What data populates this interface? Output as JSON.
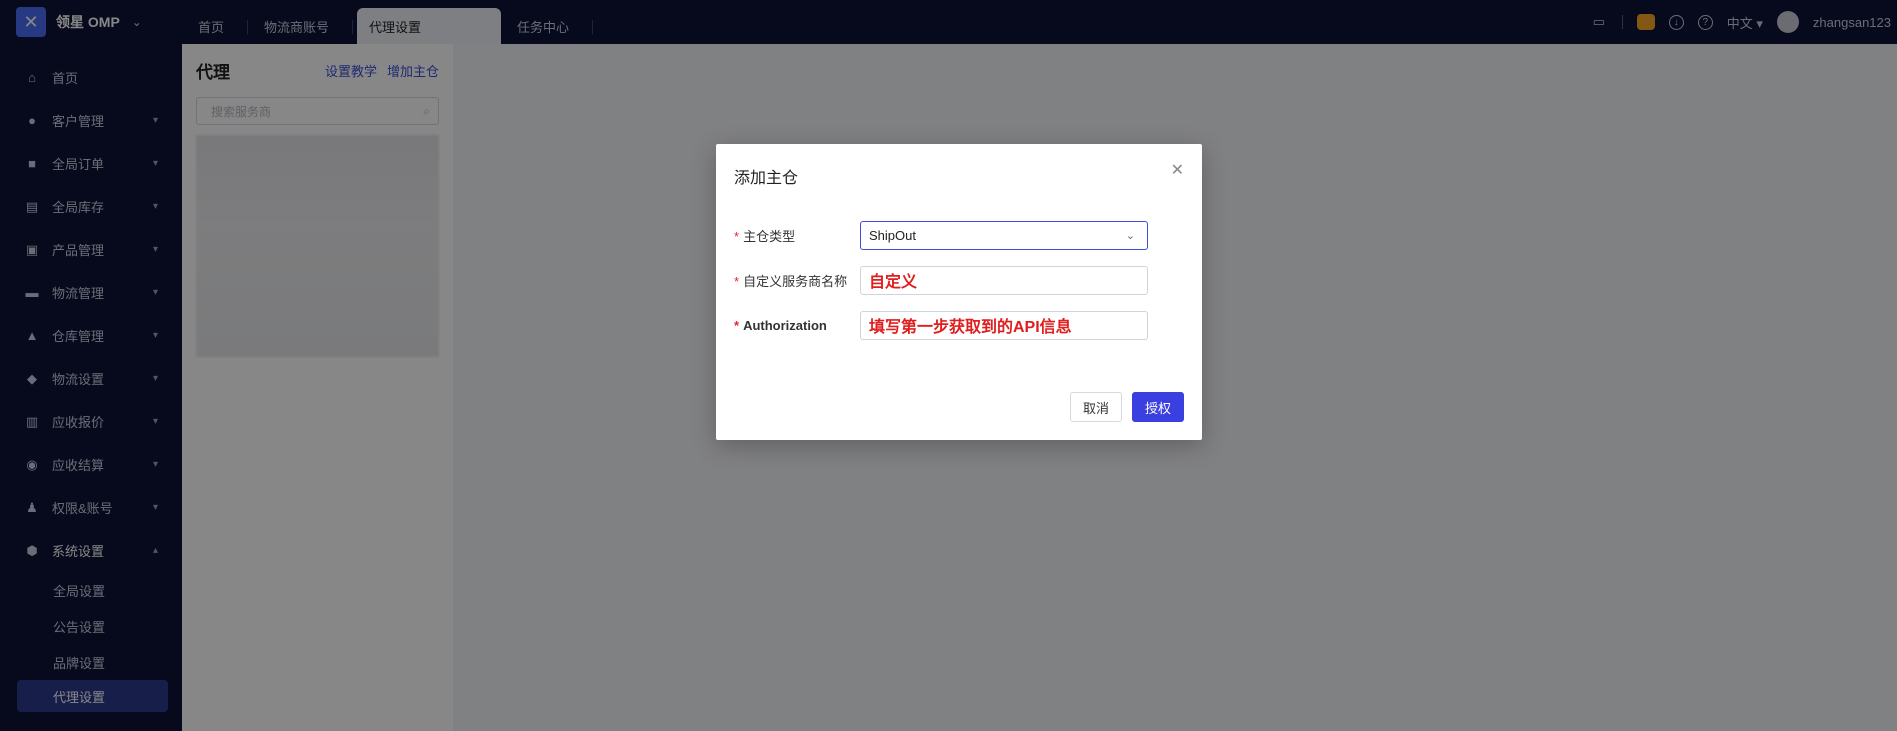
{
  "topbar": {
    "brand": "领星 OMP",
    "tabs": [
      {
        "label": "首页"
      },
      {
        "label": "物流商账号"
      },
      {
        "label": "代理设置"
      },
      {
        "label": "任务中心"
      }
    ],
    "language": "中文",
    "user": "zhangsan123"
  },
  "sidebar": {
    "items": [
      {
        "label": "首页",
        "icon": "home-icon"
      },
      {
        "label": "客户管理",
        "icon": "users-icon"
      },
      {
        "label": "全局订单",
        "icon": "orders-icon"
      },
      {
        "label": "全局库存",
        "icon": "inventory-icon"
      },
      {
        "label": "产品管理",
        "icon": "product-icon"
      },
      {
        "label": "物流管理",
        "icon": "truck-icon"
      },
      {
        "label": "仓库管理",
        "icon": "warehouse-icon"
      },
      {
        "label": "物流设置",
        "icon": "logistics-settings-icon"
      },
      {
        "label": "应收报价",
        "icon": "quote-icon"
      },
      {
        "label": "应收结算",
        "icon": "settlement-icon"
      },
      {
        "label": "权限&账号",
        "icon": "permissions-icon"
      },
      {
        "label": "系统设置",
        "icon": "settings-icon"
      }
    ],
    "sub_items": [
      {
        "label": "全局设置"
      },
      {
        "label": "公告设置"
      },
      {
        "label": "品牌设置"
      },
      {
        "label": "代理设置"
      }
    ]
  },
  "panel": {
    "title": "代理",
    "link_tutorial": "设置教学",
    "link_add": "增加主仓",
    "search_placeholder": "搜索服务商"
  },
  "modal": {
    "title": "添加主仓",
    "fields": {
      "type_label": "主仓类型",
      "type_value": "ShipOut",
      "name_label": "自定义服务商名称",
      "name_value": "自定义",
      "auth_label": "Authorization",
      "auth_value": "填写第一步获取到的API信息"
    },
    "cancel": "取消",
    "confirm": "授权"
  },
  "colors": {
    "nav_bg": "#0e1438",
    "primary": "#3a3fe0",
    "note_red": "#e01e1e"
  }
}
